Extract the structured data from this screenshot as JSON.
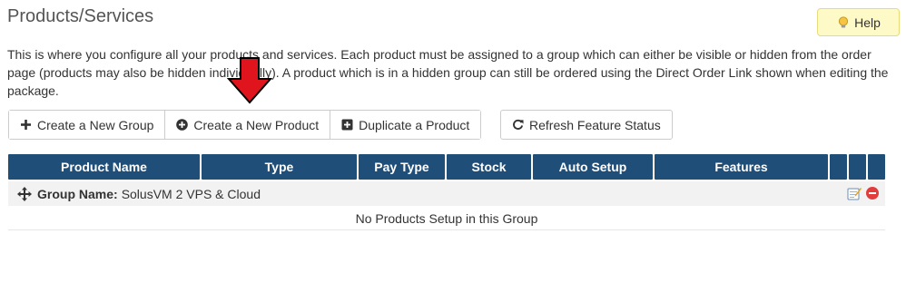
{
  "page": {
    "title": "Products/Services",
    "help_label": "Help",
    "intro": "This is where you configure all your products and services. Each product must be assigned to a group which can either be visible or hidden from the order page (products may also be hidden individually). A product which is in a hidden group can still be ordered using the Direct Order Link shown when editing the package."
  },
  "toolbar": {
    "create_group": "Create a New Group",
    "create_product": "Create a New Product",
    "duplicate_product": "Duplicate a Product",
    "refresh_feature_status": "Refresh Feature Status"
  },
  "table": {
    "columns": [
      "Product Name",
      "Type",
      "Pay Type",
      "Stock",
      "Auto Setup",
      "Features",
      "",
      "",
      ""
    ],
    "group": {
      "label": "Group Name:",
      "name": "SolusVM 2 VPS & Cloud"
    },
    "empty_message": "No Products Setup in this Group"
  },
  "colors": {
    "header_bg": "#1f4e79",
    "help_bg": "#fefac8",
    "arrow": "#e0141c"
  }
}
